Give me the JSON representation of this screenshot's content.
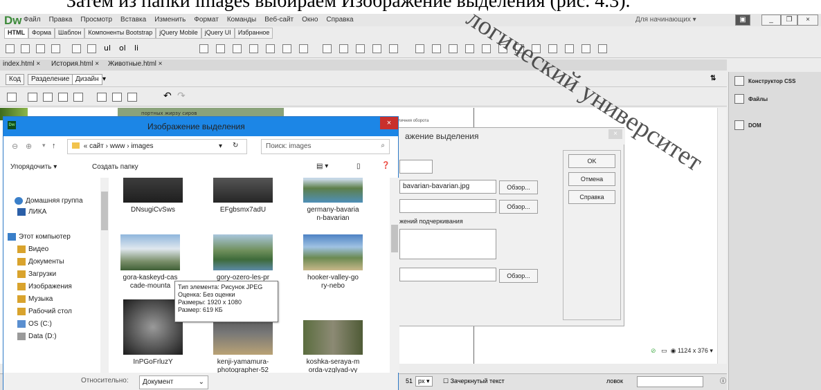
{
  "doc_header": "Затем из папки images выбираем Изображение выделения (рис. 4.3).",
  "watermark": "логический университет",
  "menubar": {
    "logo": "Dw",
    "items": [
      "Файл",
      "Правка",
      "Просмотр",
      "Вставка",
      "Изменить",
      "Формат",
      "Команды",
      "Веб-сайт",
      "Окно",
      "Справка"
    ],
    "workspace": "Для начинающих",
    "window_buttons": [
      "_",
      "❐",
      "×"
    ]
  },
  "insert_tabs": [
    "HTML",
    "Форма",
    "Шаблон",
    "Компоненты Bootstrap",
    "jQuery Mobile",
    "jQuery UI",
    "Избранное"
  ],
  "doc_tabs": [
    "index.html",
    "История.html",
    "Животные.html"
  ],
  "view_buttons": [
    "Код",
    "Разделение",
    "Дизайн"
  ],
  "design_strip_text": "портных жирзу сиров",
  "right_panel": [
    "Конструктор CSS",
    "Файлы",
    "DOM"
  ],
  "status": {
    "size": "1124 x 376"
  },
  "propbar": {
    "value": "51",
    "unit": "px",
    "checkbox_label": "Зачеркнутый текст",
    "label2": "ловок"
  },
  "background_dialog": {
    "title": "ажение выделения",
    "topbar_text": "еличния оборота",
    "file_value": "bavarian-bavarian.jpg",
    "browse": "Обзор...",
    "underline_label": "жений подчеркивания",
    "buttons": [
      "OK",
      "Отмена",
      "Справка"
    ]
  },
  "file_dialog": {
    "title": "Изображение выделения",
    "close": "×",
    "path": [
      "« сайт",
      "www",
      "images"
    ],
    "search_placeholder": "Поиск: images",
    "organize": "Упорядочить",
    "new_folder": "Создать папку",
    "nav_items": [
      {
        "label": "Домашняя группа",
        "color": "#3a7fc9"
      },
      {
        "label": "ЛИКА",
        "color": "#2b5fa8"
      },
      {
        "label": "Этот компьютер",
        "color": "#3a7fc9"
      },
      {
        "label": "Видео",
        "color": "#d9a32d"
      },
      {
        "label": "Документы",
        "color": "#d9a32d"
      },
      {
        "label": "Загрузки",
        "color": "#d9a32d"
      },
      {
        "label": "Изображения",
        "color": "#d9a32d"
      },
      {
        "label": "Музыка",
        "color": "#d9a32d"
      },
      {
        "label": "Рабочий стол",
        "color": "#d9a32d"
      },
      {
        "label": "OS (C:)",
        "color": "#5a8fd0"
      },
      {
        "label": "Data (D:)",
        "color": "#9a9a9a"
      }
    ],
    "files": [
      {
        "name": [
          "DNsugiCvSws"
        ],
        "thumb": "dark-forest"
      },
      {
        "name": [
          "EFgbsmx7adU"
        ],
        "thumb": "dark-road"
      },
      {
        "name": [
          "germany-bavaria",
          "n-bavarian"
        ],
        "thumb": "mountains-lake"
      },
      {
        "name": [
          "gora-kaskeyd-cas",
          "cade-mounta"
        ],
        "thumb": "snow-mountain",
        "selected": true
      },
      {
        "name": [
          "gory-ozero-les-pr"
        ],
        "thumb": "forest-lake"
      },
      {
        "name": [
          "hooker-valley-go",
          "ry-nebo"
        ],
        "thumb": "valley"
      },
      {
        "name": [
          "InPGoFrluzY"
        ],
        "thumb": "dark-fog"
      },
      {
        "name": [
          "kenji-yamamura-",
          "photographer-52"
        ],
        "thumb": "path"
      },
      {
        "name": [
          "koshka-seraya-m",
          "orda-vzglyad-vy"
        ],
        "thumb": "cat"
      }
    ],
    "relative_label": "Относительно:",
    "relative_value": "Документ"
  },
  "tooltip": [
    "Тип элемента: Рисунок JPEG",
    "Оценка: Без оценки",
    "Размеры: 1920 x 1080",
    "Размер: 619 КБ"
  ],
  "colors": {
    "title_blue": "#1c86e6",
    "close_red": "#c9302c",
    "selection": "#cde8ff",
    "dw_green": "#3d8a3a"
  }
}
